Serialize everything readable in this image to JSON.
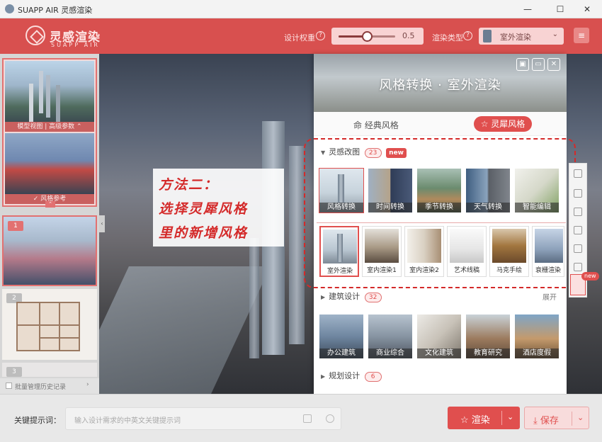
{
  "window": {
    "title": "SUAPP AIR 灵感渲染",
    "controls": [
      "—",
      "☐",
      "✕"
    ]
  },
  "header": {
    "brand_cn": "灵感渲染",
    "brand_en": "SUAPP AIR",
    "design_weight_label": "设计权重",
    "design_weight_value": "0.5",
    "design_weight": 0.5,
    "render_type_label": "渲染类型",
    "render_type_value": "室外渲染",
    "help": "?",
    "menu": "≡",
    "chevron": "⌄"
  },
  "left_panel": {
    "model_caption": "模型视图 | 高级参数 ⌃",
    "style_caption": "✓ 风格参考",
    "history_badges": [
      "1",
      "2",
      "3"
    ],
    "batch_label": "批量管理历史记录",
    "batch_chevron": "›",
    "collapse": "⌃"
  },
  "dialog": {
    "title": "风格转换 · 室外渲染",
    "tab_classic": "命 经典风格",
    "tab_lingxi": "☆ 灵犀风格",
    "sections": {
      "inspiration": {
        "label": "灵感改图",
        "count": "23",
        "badge": "new"
      },
      "architecture": {
        "label": "建筑设计",
        "count": "32",
        "expand": "展开"
      },
      "planning": {
        "label": "规划设计",
        "count": "6"
      }
    },
    "inspiration_cards": [
      {
        "label": "风格转换",
        "selected": true
      },
      {
        "label": "时间转换",
        "selected": false
      },
      {
        "label": "季节转换",
        "selected": false
      },
      {
        "label": "天气转换",
        "selected": false
      },
      {
        "label": "智能编辑",
        "selected": false
      }
    ],
    "sub_cards": [
      {
        "label": "室外渲染",
        "selected": true
      },
      {
        "label": "室内渲染1",
        "selected": false
      },
      {
        "label": "室内渲染2",
        "selected": false
      },
      {
        "label": "艺术线稿",
        "selected": false
      },
      {
        "label": "马克手绘",
        "selected": false
      },
      {
        "label": "衰栅渲染",
        "selected": false
      }
    ],
    "architecture_cards": [
      {
        "label": "办公建筑"
      },
      {
        "label": "商业综合"
      },
      {
        "label": "文化建筑"
      },
      {
        "label": "教育研究"
      },
      {
        "label": "酒店度假"
      }
    ]
  },
  "annotation": {
    "line1": "方法二：",
    "line2": "选择灵犀风格",
    "line3": "里的新增风格"
  },
  "side_badge": "new",
  "bottom": {
    "keyword_label": "关键提示词：",
    "prompt_placeholder": "输入设计需求的中英文关键提示词",
    "render_label": "☆ 渲染",
    "save_label": "⤓ 保存",
    "chevron": "⌄"
  },
  "colors": {
    "brand_red": "#d8504f",
    "accent_red": "#e04f4e",
    "annotation_red": "#d42a2a"
  }
}
